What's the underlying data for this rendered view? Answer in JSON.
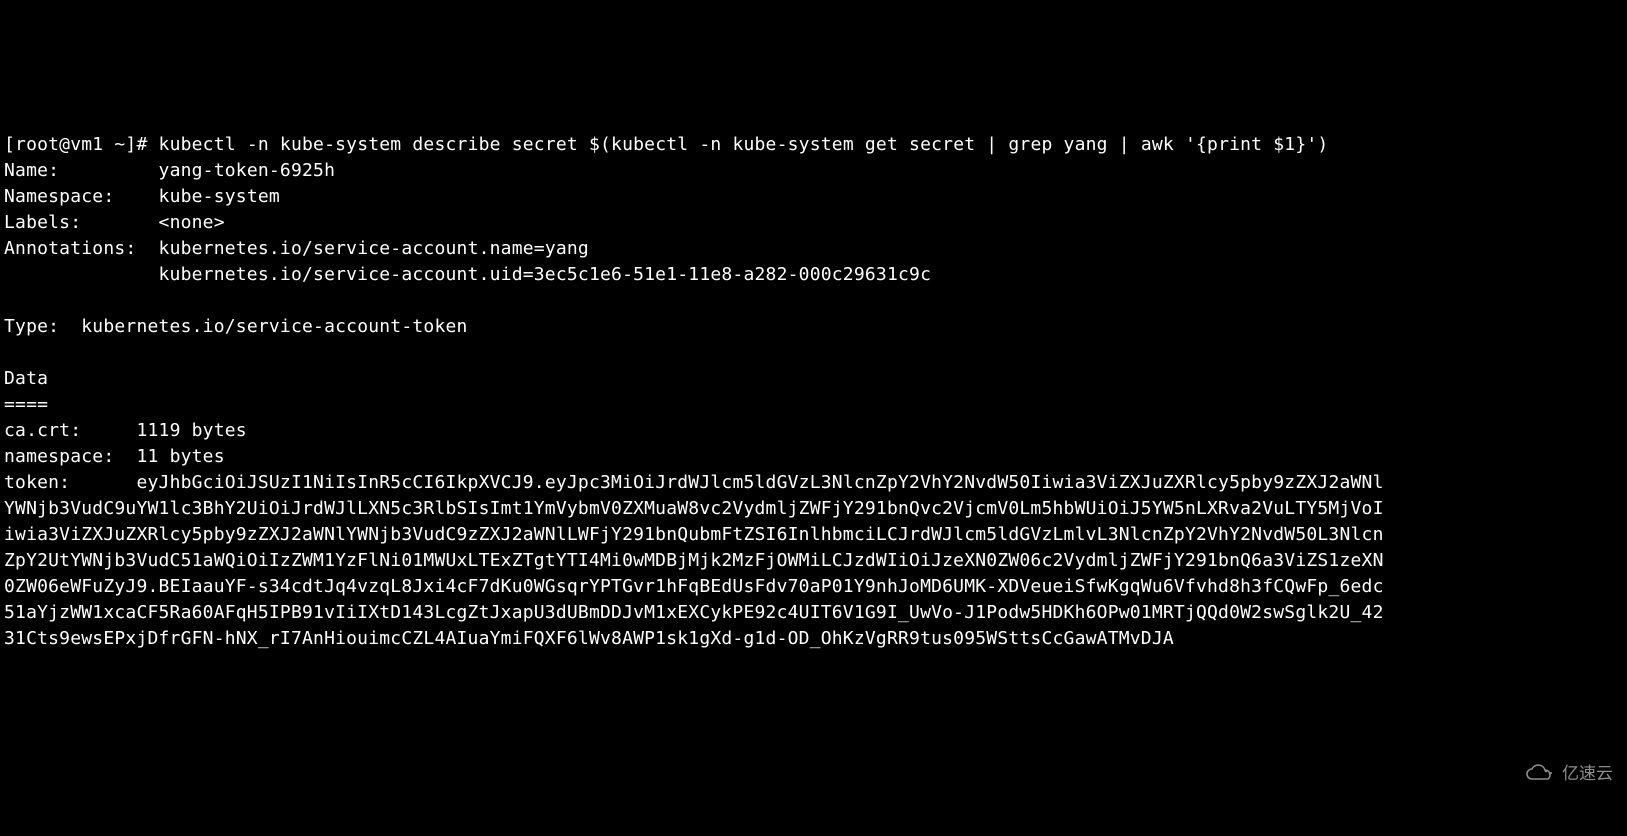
{
  "prompt": "[root@vm1 ~]# ",
  "command": "kubectl -n kube-system describe secret $(kubectl -n kube-system get secret | grep yang | awk '{print $1}')",
  "fields": {
    "name_k": "Name:         ",
    "name_v": "yang-token-6925h",
    "namespace_k": "Namespace:    ",
    "namespace_v": "kube-system",
    "labels_k": "Labels:       ",
    "labels_v": "<none>",
    "annotations_k": "Annotations:  ",
    "annotations_v1": "kubernetes.io/service-account.name=yang",
    "annotations_v2": "              kubernetes.io/service-account.uid=3ec5c1e6-51e1-11e8-a282-000c29631c9c",
    "type_k": "Type:  ",
    "type_v": "kubernetes.io/service-account-token",
    "data_header": "Data",
    "data_sep": "====",
    "ca_k": "ca.crt:     ",
    "ca_v": "1119 bytes",
    "ns_k": "namespace:  ",
    "ns_v": "11 bytes",
    "token_k": "token:      ",
    "token_l1": "eyJhbGciOiJSUzI1NiIsInR5cCI6IkpXVCJ9.eyJpc3MiOiJrdWJlcm5ldGVzL3NlcnZpY2VhY2NvdW50Iiwia3ViZXJuZXRlcy5pby9zZXJ2aWNl",
    "token_l2": "YWNjb3VudC9uYW1lc3BhY2UiOiJrdWJlLXN5c3RlbSIsImt1YmVybmV0ZXMuaW8vc2VydmljZWFjY291bnQvc2VjcmV0Lm5hbWUiOiJ5YW5nLXRva2VuLTY5MjVoI",
    "token_l3": "iwia3ViZXJuZXRlcy5pby9zZXJ2aWNlYWNjb3VudC9zZXJ2aWNlLWFjY291bnQubmFtZSI6InlhbmciLCJrdWJlcm5ldGVzLmlvL3NlcnZpY2VhY2NvdW50L3Nlcn",
    "token_l4": "ZpY2UtYWNjb3VudC51aWQiOiIzZWM1YzFlNi01MWUxLTExZTgtYTI4Mi0wMDBjMjk2MzFjOWMiLCJzdWIiOiJzeXN0ZW06c2VydmljZWFjY291bnQ6a3ViZS1zeXN",
    "token_l5": "0ZW06eWFuZyJ9.BEIaauYF-s34cdtJq4vzqL8Jxi4cF7dKu0WGsqrYPTGvr1hFqBEdUsFdv70aP01Y9nhJoMD6UMK-XDVeueiSfwKgqWu6Vfvhd8h3fCQwFp_6edc",
    "token_l6": "51aYjzWW1xcaCF5Ra60AFqH5IPB91vIiIXtD143LcgZtJxapU3dUBmDDJvM1xEXCykPE92c4UIT6V1G9I_UwVo-J1Podw5HDKh6OPw01MRTjQQd0W2swSglk2U_42",
    "token_l7": "31Cts9ewsEPxjDfrGFN-hNX_rI7AnHiouimcCZL4AIuaYmiFQXF6lWv8AWP1sk1gXd-g1d-OD_OhKzVgRR9tus095WSttsCcGawATMvDJA"
  },
  "watermark": {
    "text": "亿速云"
  }
}
